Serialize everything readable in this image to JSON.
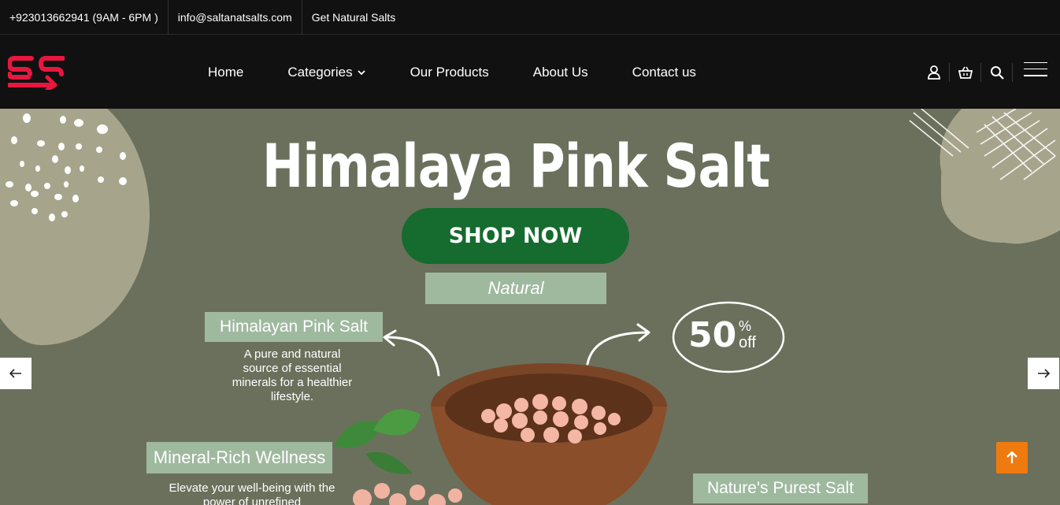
{
  "topbar": {
    "phone": "+923013662941 (9AM - 6PM )",
    "email": "info@saltanatsalts.com",
    "promo": "Get Natural Salts"
  },
  "brand": {
    "logo_icon": "ss-logo-icon",
    "accent": "#e8173f"
  },
  "nav": {
    "items": [
      "Home",
      "Categories",
      "Our Products",
      "About Us",
      "Contact us"
    ]
  },
  "header_icons": [
    "user-icon",
    "basket-icon",
    "search-icon",
    "menu-icon"
  ],
  "hero": {
    "title": "Himalaya Pink Salt",
    "cta": "SHOP NOW",
    "cta_color": "#166b2e",
    "tag_natural": "Natural",
    "tag_hps": "Himalayan Pink Salt",
    "desc_hps": "A pure and natural source of essential minerals for a healthier lifestyle.",
    "tag_mrw": "Mineral-Rich Wellness",
    "desc_mrw": "Elevate your well-being with the power of unrefined",
    "discount_value": "50",
    "discount_percent": "%",
    "discount_off": "off",
    "tag_nps": "Nature's Purest Salt",
    "bg_color": "#6b705c"
  },
  "controls": {
    "prev_icon": "arrow-left-icon",
    "next_icon": "arrow-right-icon",
    "scroll_top_icon": "arrow-up-icon",
    "scroll_top_color": "#ef7a0f"
  }
}
